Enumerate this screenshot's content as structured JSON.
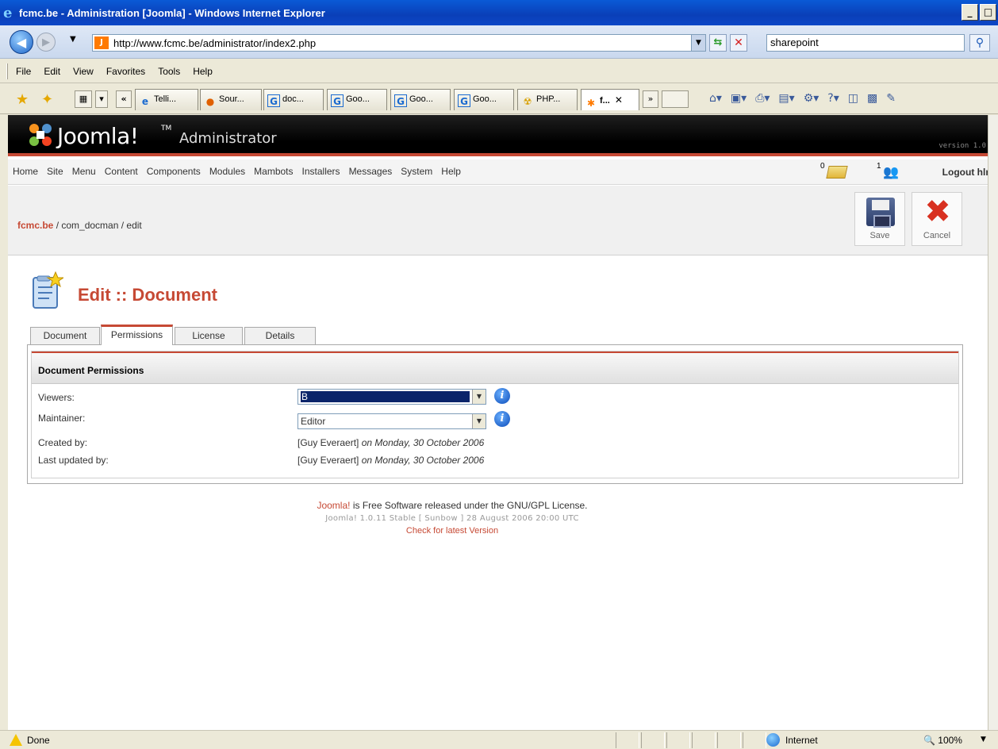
{
  "window": {
    "title": "fcmc.be - Administration [Joomla] - Windows Internet Explorer",
    "min": "_",
    "max": "□"
  },
  "address": {
    "url": "http://www.fcmc.be/administrator/index2.php",
    "search": "sharepoint"
  },
  "menu": [
    "File",
    "Edit",
    "View",
    "Favorites",
    "Tools",
    "Help"
  ],
  "browser_tabs": [
    {
      "label": "Telli...",
      "icon": "ie-icon"
    },
    {
      "label": "Sour...",
      "icon": "firefox-icon"
    },
    {
      "label": "doc...",
      "icon": "google-icon"
    },
    {
      "label": "Goo...",
      "icon": "google-icon"
    },
    {
      "label": "Goo...",
      "icon": "google-icon"
    },
    {
      "label": "Goo...",
      "icon": "google-icon"
    },
    {
      "label": "PHP...",
      "icon": "php-icon"
    },
    {
      "label": "f...",
      "icon": "joomla-icon"
    }
  ],
  "tab_overflow": "»",
  "joomla": {
    "logo": "Joomla!",
    "logo_tm": "TM",
    "admin_label": "Administrator",
    "version": "version 1.0",
    "nav": [
      "Home",
      "Site",
      "Menu",
      "Content",
      "Components",
      "Modules",
      "Mambots",
      "Installers",
      "Messages",
      "System",
      "Help"
    ],
    "messages_count": "0",
    "users_count": "1",
    "logout": "Logout hlr"
  },
  "breadcrumb": {
    "site": "fcmc.be",
    "path": " / com_docman / edit"
  },
  "toolbar": {
    "save": "Save",
    "cancel": "Cancel"
  },
  "page": {
    "heading": "Edit :: Document",
    "tabs": [
      "Document",
      "Permissions",
      "License",
      "Details"
    ],
    "active_tab": "Permissions",
    "panel_title": "Document Permissions",
    "fields": {
      "viewers_label": "Viewers:",
      "viewers_value": "B",
      "maintainer_label": "Maintainer:",
      "maintainer_value": "Editor",
      "created_label": "Created by:",
      "created_user": "[Guy Everaert]",
      "created_date": "on Monday, 30 October 2006",
      "updated_label": "Last updated by:",
      "updated_user": "[Guy Everaert]",
      "updated_date": "on Monday, 30 October 2006"
    }
  },
  "footer": {
    "brand": "Joomla!",
    "line1_rest": " is Free Software released under the GNU/GPL License.",
    "line2": "Joomla! 1.0.11 Stable [ Sunbow ] 28 August 2006 20:00 UTC",
    "line3": "Check for latest Version"
  },
  "status": {
    "text": "Done",
    "zone": "Internet",
    "zoom": "100%"
  },
  "colors": {
    "joomla_accent": "#c64934",
    "xp_title": "#0a3fb8"
  }
}
